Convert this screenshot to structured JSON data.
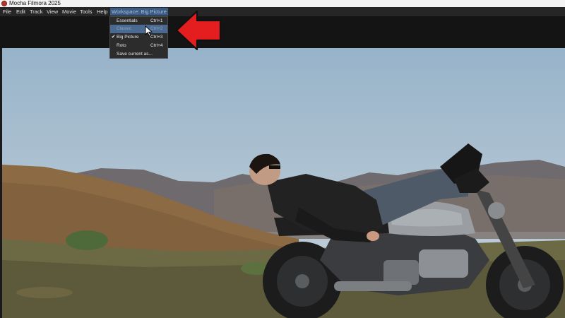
{
  "window": {
    "title": "Mocha Filmora 2025",
    "icon": "mocha-app-icon"
  },
  "menubar": {
    "items": [
      "File",
      "Edit",
      "Track",
      "View",
      "Movie",
      "Tools",
      "Help",
      "Workspace: Big Picture"
    ],
    "active_item": "Workspace: Big Picture"
  },
  "workspace_menu": {
    "items": [
      {
        "label": "Essentials",
        "shortcut": "Ctrl+1",
        "checked": false,
        "highlighted": false
      },
      {
        "label": "Classic",
        "shortcut": "Ctrl+2",
        "checked": false,
        "highlighted": true
      },
      {
        "label": "Big Picture",
        "shortcut": "Ctrl+3",
        "checked": true,
        "highlighted": false
      },
      {
        "label": "Roto",
        "shortcut": "Ctrl+4",
        "checked": false,
        "highlighted": false
      },
      {
        "label": "Save current as...",
        "shortcut": "",
        "checked": false,
        "highlighted": false
      }
    ],
    "check_glyph": "✔"
  },
  "annotation": {
    "icon": "red-arrow-icon",
    "color": "#e41e1e"
  },
  "viewer": {
    "content": "video-frame"
  },
  "colors": {
    "menu_highlight": "#3b5b85",
    "dropdown_bg": "#2c2c2c",
    "titlebar_bg": "#f3f3f3",
    "menubar_bg": "#262626"
  }
}
